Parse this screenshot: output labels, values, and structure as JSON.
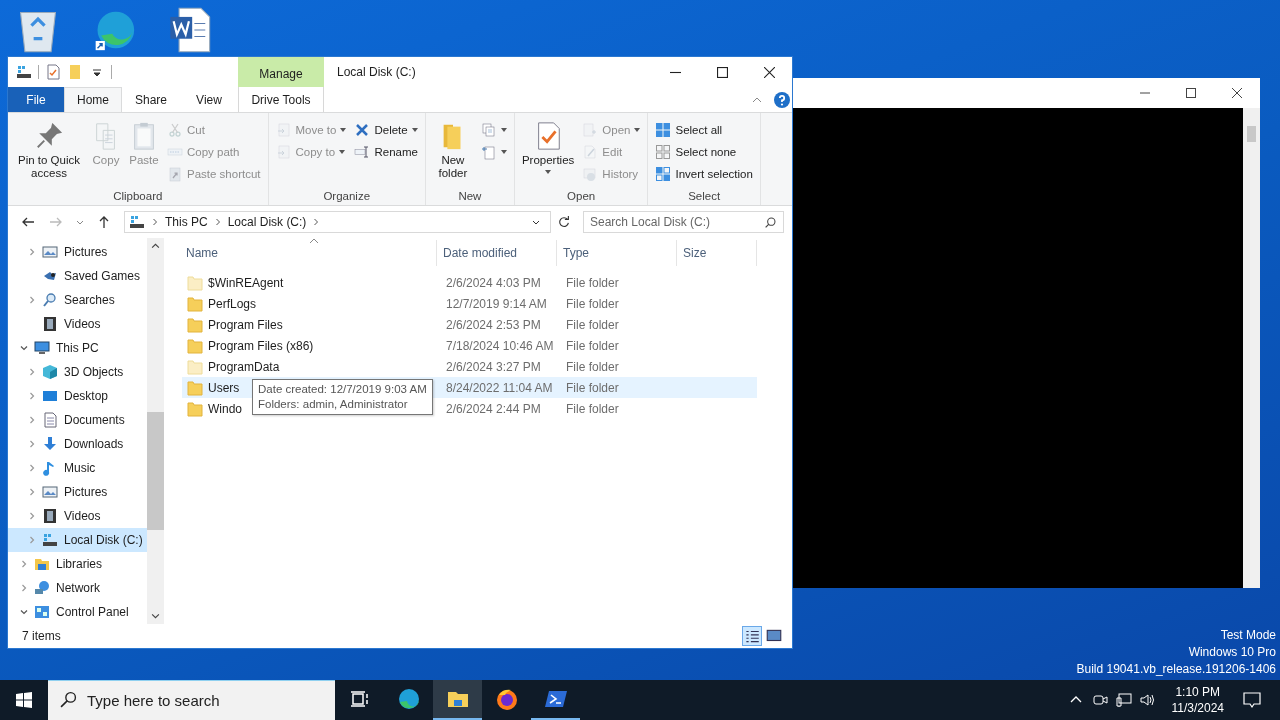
{
  "explorer": {
    "title": "Local Disk (C:)",
    "contextual_header": "Manage",
    "tabs": [
      {
        "label": "File",
        "kind": "file",
        "selected": false
      },
      {
        "label": "Home",
        "kind": "tab",
        "selected": true
      },
      {
        "label": "Share",
        "kind": "tab",
        "selected": false
      },
      {
        "label": "View",
        "kind": "tab",
        "selected": false
      },
      {
        "label": "Drive Tools",
        "kind": "contextual",
        "selected": false
      }
    ],
    "ribbon_groups": [
      {
        "label": "Clipboard",
        "columns": [
          [
            {
              "label": "Pin to Quick access",
              "kind": "pin",
              "disabled": false
            }
          ],
          [
            {
              "label": "Copy",
              "kind": "copy",
              "disabled": true
            }
          ],
          [
            {
              "label": "Paste",
              "kind": "paste",
              "disabled": true
            }
          ],
          [
            {
              "label": "Cut",
              "kind": "cut",
              "disabled": true
            },
            {
              "label": "Copy path",
              "kind": "copy-path",
              "disabled": true
            },
            {
              "label": "Paste shortcut",
              "kind": "paste-shortcut",
              "disabled": true
            }
          ]
        ]
      },
      {
        "label": "Organize",
        "columns": [
          [
            {
              "label": "Move to",
              "kind": "move-to",
              "disabled": true,
              "dropdown": true
            },
            {
              "label": "Copy to",
              "kind": "copy-to",
              "disabled": true,
              "dropdown": true
            }
          ],
          [
            {
              "label": "Delete",
              "kind": "delete",
              "disabled": false,
              "dropdown": true
            },
            {
              "label": "Rename",
              "kind": "rename",
              "disabled": false
            }
          ]
        ]
      },
      {
        "label": "New",
        "columns": [
          [
            {
              "label": "New folder",
              "kind": "new-folder",
              "disabled": false
            }
          ],
          [
            {
              "kind": "new-item",
              "disabled": false,
              "dropdown": true
            },
            {
              "kind": "easy-access",
              "disabled": false,
              "dropdown": true
            }
          ]
        ]
      },
      {
        "label": "Open",
        "columns": [
          [
            {
              "label": "Properties",
              "kind": "properties",
              "disabled": false,
              "dropdown": true
            }
          ],
          [
            {
              "label": "Open",
              "kind": "open",
              "disabled": true,
              "dropdown": true
            },
            {
              "label": "Edit",
              "kind": "edit",
              "disabled": true
            },
            {
              "label": "History",
              "kind": "history",
              "disabled": true
            }
          ]
        ]
      },
      {
        "label": "Select",
        "columns": [
          [
            {
              "label": "Select all",
              "kind": "select-all",
              "disabled": false
            },
            {
              "label": "Select none",
              "kind": "select-none",
              "disabled": false
            },
            {
              "label": "Invert selection",
              "kind": "invert",
              "disabled": false
            }
          ]
        ]
      }
    ],
    "address": {
      "crumbs": [
        "This PC",
        "Local Disk (C:)"
      ],
      "search_placeholder": "Search Local Disk (C:)"
    },
    "nav_tree": [
      {
        "children": [
          {
            "label": "Pictures",
            "kind": "pictures",
            "expandable": true,
            "expanded": false,
            "selected": false
          },
          {
            "label": "Saved Games",
            "kind": "games",
            "expandable": false,
            "selected": false
          },
          {
            "label": "Searches",
            "kind": "search",
            "expandable": true,
            "expanded": false,
            "selected": false
          },
          {
            "label": "Videos",
            "kind": "videos",
            "expandable": false,
            "selected": false
          }
        ]
      },
      {
        "label": "This PC",
        "kind": "pc",
        "expandable": true,
        "expanded": true,
        "selected": false,
        "children": [
          {
            "label": "3D Objects",
            "kind": "cube",
            "expandable": true,
            "expanded": false,
            "selected": false
          },
          {
            "label": "Desktop",
            "kind": "desktop",
            "expandable": true,
            "expanded": false,
            "selected": false
          },
          {
            "label": "Documents",
            "kind": "documents",
            "expandable": true,
            "expanded": false,
            "selected": false
          },
          {
            "label": "Downloads",
            "kind": "downloads",
            "expandable": true,
            "expanded": false,
            "selected": false
          },
          {
            "label": "Music",
            "kind": "music",
            "expandable": true,
            "expanded": false,
            "selected": false
          },
          {
            "label": "Pictures",
            "kind": "pictures",
            "expandable": true,
            "expanded": false,
            "selected": false
          },
          {
            "label": "Videos",
            "kind": "videos",
            "expandable": true,
            "expanded": false,
            "selected": false
          },
          {
            "label": "Local Disk (C:)",
            "kind": "disk",
            "expandable": true,
            "expanded": false,
            "selected": true
          }
        ]
      },
      {
        "label": "Libraries",
        "kind": "libraries",
        "expandable": true,
        "expanded": false,
        "selected": false
      },
      {
        "label": "Network",
        "kind": "network",
        "expandable": true,
        "expanded": false,
        "selected": false
      },
      {
        "label": "Control Panel",
        "kind": "control-panel",
        "expandable": true,
        "expanded": true,
        "selected": false
      }
    ],
    "columns": [
      {
        "label": "Name",
        "sorted": true
      },
      {
        "label": "Date modified",
        "sorted": false
      },
      {
        "label": "Type",
        "sorted": false
      },
      {
        "label": "Size",
        "sorted": false
      }
    ],
    "rows": [
      {
        "name": "$WinREAgent",
        "date": "2/6/2024 4:03 PM",
        "type": "File folder",
        "hidden": true,
        "hovered": false
      },
      {
        "name": "PerfLogs",
        "date": "12/7/2019 9:14 AM",
        "type": "File folder",
        "hidden": false,
        "hovered": false
      },
      {
        "name": "Program Files",
        "date": "2/6/2024 2:53 PM",
        "type": "File folder",
        "hidden": false,
        "hovered": false
      },
      {
        "name": "Program Files (x86)",
        "date": "7/18/2024 10:46 AM",
        "type": "File folder",
        "hidden": false,
        "hovered": false
      },
      {
        "name": "ProgramData",
        "date": "2/6/2024 3:27 PM",
        "type": "File folder",
        "hidden": true,
        "hovered": false
      },
      {
        "name": "Users",
        "date": "8/24/2022 11:04 AM",
        "type": "File folder",
        "hidden": false,
        "hovered": true,
        "tooltip": [
          "Date created: 12/7/2019 9:03 AM",
          "Folders: admin, Administrator"
        ]
      },
      {
        "name": "Windo",
        "date": "2/6/2024 2:44 PM",
        "type": "File folder",
        "hidden": false,
        "hovered": false
      }
    ],
    "status": {
      "item_count": "7 items",
      "views": [
        {
          "kind": "details",
          "selected": true
        },
        {
          "kind": "large-icons",
          "selected": false
        }
      ]
    }
  },
  "desktop_info": [
    "Test Mode",
    "Windows 10 Pro",
    "Build 19041.vb_release.191206-1406"
  ],
  "taskbar": {
    "search_placeholder": "Type here to search",
    "apps": [
      {
        "kind": "edge",
        "selected": false,
        "running": false
      },
      {
        "kind": "explorer",
        "selected": true,
        "running": true
      },
      {
        "kind": "firefox",
        "selected": false,
        "running": false
      },
      {
        "kind": "powershell",
        "selected": false,
        "running": true
      }
    ],
    "time": "1:10 PM",
    "date": "11/3/2024"
  }
}
